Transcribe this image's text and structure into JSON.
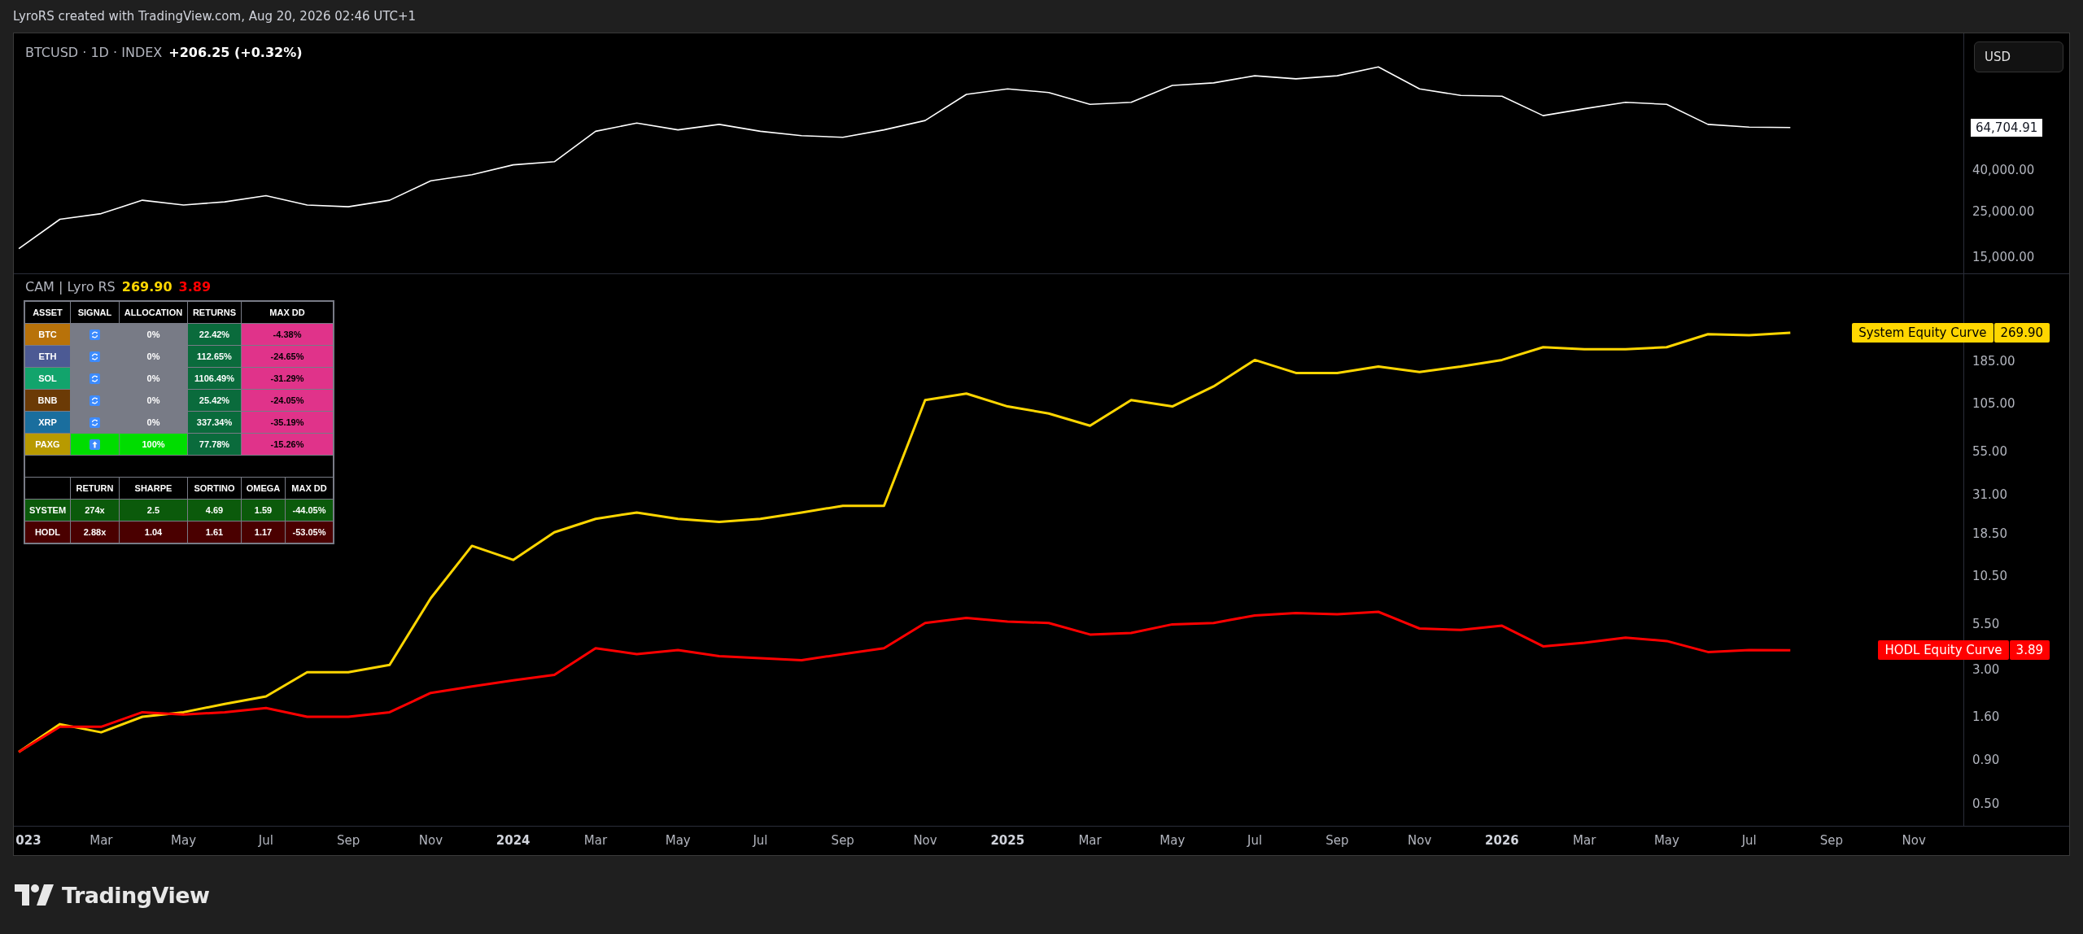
{
  "header": {
    "text": "LyroRS created with TradingView.com, Aug 20, 2026 02:46 UTC+1"
  },
  "price_pane": {
    "symbol": "BTCUSD · 1D · INDEX",
    "change": "+206.25 (+0.32%)",
    "currency_button": "USD",
    "price_label": "64,704.91",
    "axis_labels": [
      "40,000.00",
      "25,000.00",
      "15,000.00"
    ],
    "lines": [
      {
        "kind": "price",
        "color": "#ffffff"
      }
    ]
  },
  "equity_pane": {
    "legend": {
      "title": "CAM | Lyro RS",
      "values": [
        {
          "text": "269.90",
          "color": "#ffd600"
        },
        {
          "text": "3.89",
          "color": "#ff0000"
        }
      ]
    },
    "asset_table": {
      "columns": [
        "ASSET",
        "SIGNAL",
        "ALLOCATION",
        "RETURNS",
        "MAX DD"
      ],
      "rows": [
        {
          "asset": "BTC",
          "color": "#b8720a",
          "long": false,
          "allocation": "0%",
          "returns": "22.42%",
          "max_dd": "-4.38%"
        },
        {
          "asset": "ETH",
          "color": "#4c5a94",
          "long": false,
          "allocation": "0%",
          "returns": "112.65%",
          "max_dd": "-24.65%"
        },
        {
          "asset": "SOL",
          "color": "#12a46c",
          "long": false,
          "allocation": "0%",
          "returns": "1106.49%",
          "max_dd": "-31.29%"
        },
        {
          "asset": "BNB",
          "color": "#6b3a06",
          "long": false,
          "allocation": "0%",
          "returns": "25.42%",
          "max_dd": "-24.05%"
        },
        {
          "asset": "XRP",
          "color": "#1a6e9e",
          "long": false,
          "allocation": "0%",
          "returns": "337.34%",
          "max_dd": "-35.19%"
        },
        {
          "asset": "PAXG",
          "color": "#b89a00",
          "long": true,
          "allocation": "100%",
          "returns": "77.78%",
          "max_dd": "-15.26%"
        }
      ]
    },
    "summary_table": {
      "columns": [
        "RETURN",
        "SHARPE",
        "SORTINO",
        "OMEGA",
        "MAX DD"
      ],
      "rows": [
        {
          "name": "SYSTEM",
          "kind": "system",
          "values": [
            "274x",
            "2.5",
            "4.69",
            "1.59",
            "-44.05%"
          ]
        },
        {
          "name": "HODL",
          "kind": "hodl",
          "values": [
            "2.88x",
            "1.04",
            "1.61",
            "1.17",
            "-53.05%"
          ]
        }
      ]
    },
    "axis_labels": [
      "185.00",
      "105.00",
      "55.00",
      "31.00",
      "18.50",
      "10.50",
      "5.50",
      "3.00",
      "1.60",
      "0.90",
      "0.50"
    ],
    "equity_labels": [
      {
        "kind": "system",
        "name": "System Equity Curve",
        "value": "269.90",
        "color": "#ffd600"
      },
      {
        "kind": "hodl",
        "name": "HODL Equity Curve",
        "value": "3.89",
        "color": "#ff0000"
      }
    ]
  },
  "time_axis": [
    "023",
    "Mar",
    "May",
    "Jul",
    "Sep",
    "Nov",
    "2024",
    "Mar",
    "May",
    "Jul",
    "Sep",
    "Nov",
    "2025",
    "Mar",
    "May",
    "Jul",
    "Sep",
    "Nov",
    "2026",
    "Mar",
    "May",
    "Jul",
    "Sep",
    "Nov"
  ],
  "footer": {
    "brand": "TradingView"
  }
}
